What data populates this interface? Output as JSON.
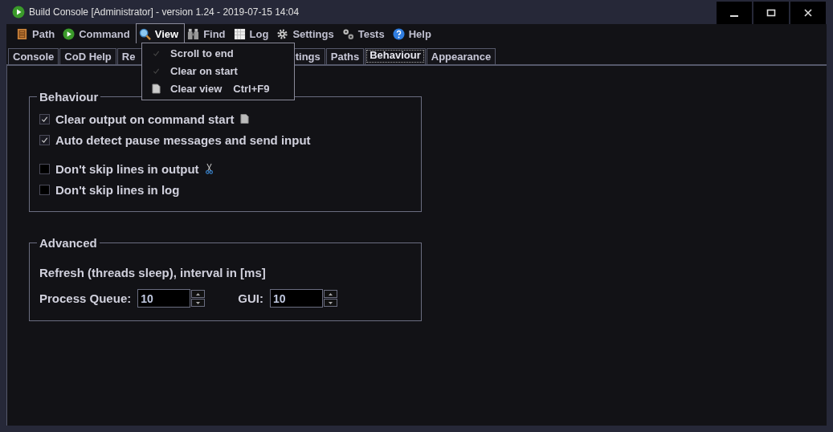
{
  "window": {
    "title": "Build Console [Administrator] - version 1.24 - 2019-07-15 14:04"
  },
  "menu": [
    {
      "label": "Path",
      "selected": false
    },
    {
      "label": "Command",
      "selected": false
    },
    {
      "label": "View",
      "selected": true
    },
    {
      "label": "Find",
      "selected": false
    },
    {
      "label": "Log",
      "selected": false
    },
    {
      "label": "Settings",
      "selected": false
    },
    {
      "label": "Tests",
      "selected": false
    },
    {
      "label": "Help",
      "selected": false
    }
  ],
  "view_menu": [
    {
      "label": "Scroll to end",
      "kind": "check",
      "checked": true
    },
    {
      "label": "Clear on start",
      "kind": "check",
      "checked": true
    },
    {
      "label": "Clear view",
      "kind": "icon",
      "shortcut": "Ctrl+F9"
    }
  ],
  "tabs": [
    {
      "label": "Console",
      "selected": false
    },
    {
      "label": "CoD Help",
      "selected": false
    },
    {
      "label": "Re",
      "selected": false
    },
    {
      "label": "tings",
      "selected": false
    },
    {
      "label": "Paths",
      "selected": false
    },
    {
      "label": "Behaviour",
      "selected": true
    },
    {
      "label": "Appearance",
      "selected": false
    }
  ],
  "behaviour": {
    "title": "Behaviour",
    "options": [
      {
        "label": "Clear output on command start",
        "checked": true
      },
      {
        "label": "Auto detect pause messages and send input",
        "checked": true
      },
      {
        "label": "Don't skip lines in output",
        "checked": false
      },
      {
        "label": "Don't skip lines in log",
        "checked": false
      }
    ]
  },
  "advanced": {
    "title": "Advanced",
    "note": "Refresh (threads sleep), interval in [ms]",
    "fields": [
      {
        "label": "Process Queue:",
        "value": "10"
      },
      {
        "label": "GUI:",
        "value": "10"
      }
    ]
  }
}
